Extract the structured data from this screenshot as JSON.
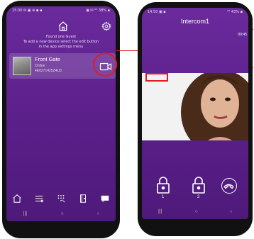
{
  "phone1": {
    "status_left": "15:30 ✉ ▣ ⊕ ◾ ▪",
    "status_right": "▣ ✉ ⁰⁰ 38% ▪",
    "hint_title": "Found one Guest",
    "hint_line1": "To add a new device select the edit button",
    "hint_line2": "in the app settings menu",
    "device": {
      "name": "Front Gate",
      "status": "Online",
      "id": "4E0271425Z4U3"
    }
  },
  "phone2": {
    "status_left": "14:50 ▣ ▪",
    "status_right": "⁰⁰ 43% ▪",
    "title": "Intercom1",
    "timer": "00:45",
    "lock1_label": "1",
    "lock2_label": "2"
  },
  "icons": {
    "home": "home-icon",
    "settings": "gear-icon",
    "video": "video-camera-icon",
    "lock": "lock-icon",
    "hangup": "hang-up-icon"
  },
  "colors": {
    "purple": "#5b1f8a",
    "highlight_red": "#e21b23"
  }
}
